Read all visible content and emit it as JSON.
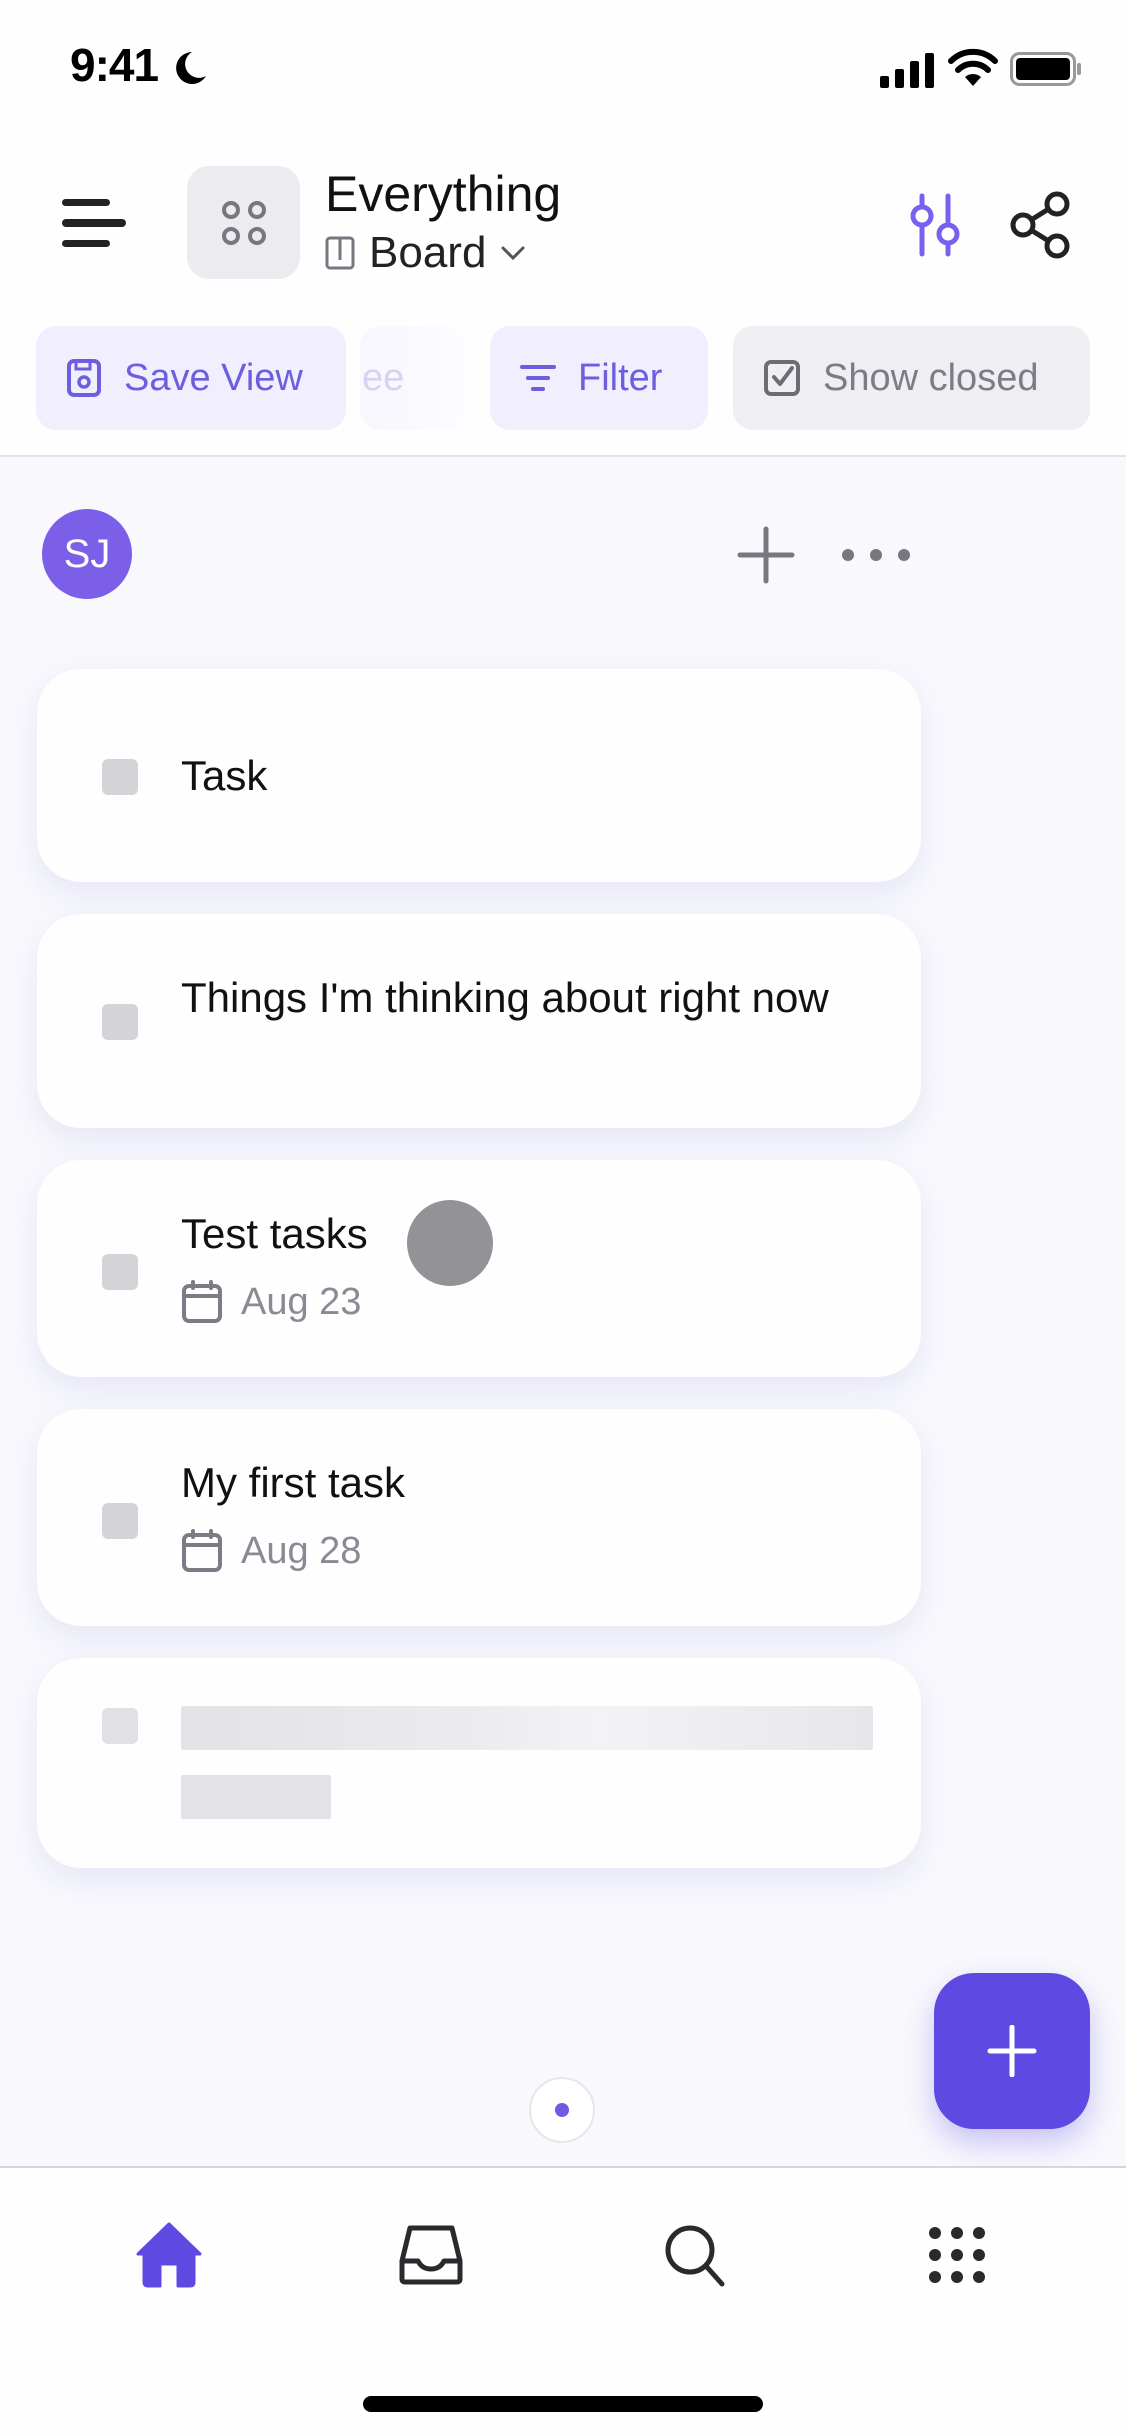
{
  "status_bar": {
    "time": "9:41",
    "focus_icon": "moon-icon",
    "signal_icon": "cellular-signal-icon",
    "wifi_icon": "wifi-icon",
    "battery_icon": "battery-icon"
  },
  "header": {
    "title": "Everything",
    "view": {
      "label": "Board",
      "icon": "board-icon"
    },
    "menu_icon": "hamburger-menu-icon",
    "space_icon": "space-grid-icon",
    "actions": [
      {
        "name": "customize",
        "icon": "sliders-icon"
      },
      {
        "name": "share",
        "icon": "share-icon"
      }
    ]
  },
  "toolbar": {
    "chips": [
      {
        "label": "Save View",
        "icon": "floppy-disk-icon"
      },
      {
        "label": "ee",
        "note": "partially visible chip"
      },
      {
        "label": "Filter",
        "icon": "filter-icon"
      },
      {
        "label": "Show closed",
        "icon": "checkbox-checked-icon"
      }
    ]
  },
  "board": {
    "group": {
      "avatar_initials": "SJ",
      "avatar_color": "#7b5fe8",
      "add_icon": "plus-icon",
      "more_icon": "more-horizontal-icon"
    },
    "tasks": [
      {
        "title": "Task",
        "date": null
      },
      {
        "title": "Things I'm thinking about right now",
        "date": null
      },
      {
        "title": "Test tasks",
        "date": "Aug 23"
      },
      {
        "title": "My first task",
        "date": "Aug 28"
      }
    ],
    "loading_placeholder": true
  },
  "fab": {
    "icon": "plus-icon",
    "color": "#5e4ae3"
  },
  "tabbar": {
    "items": [
      {
        "name": "home",
        "icon": "home-icon",
        "active": true
      },
      {
        "name": "inbox",
        "icon": "inbox-icon",
        "active": false
      },
      {
        "name": "search",
        "icon": "search-icon",
        "active": false
      },
      {
        "name": "apps",
        "icon": "apps-grid-icon",
        "active": false
      }
    ]
  },
  "colors": {
    "accent": "#6d5ee0",
    "accent_strong": "#5e4ae3",
    "muted_text": "#8a8a94",
    "background": "#f8f8fd"
  }
}
